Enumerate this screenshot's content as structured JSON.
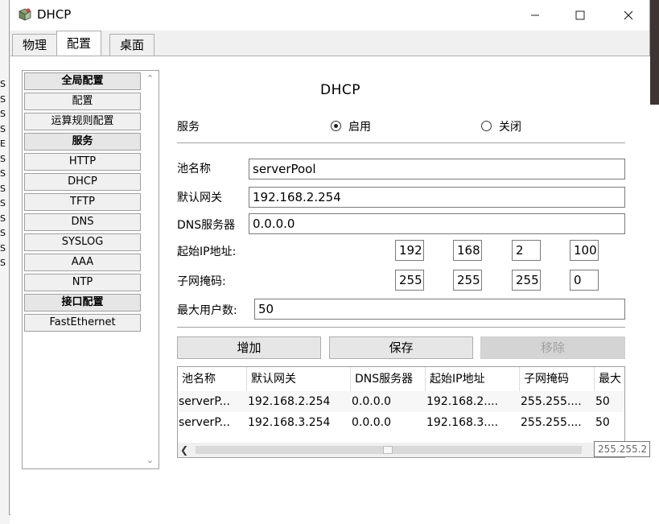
{
  "window": {
    "title": "DHCP",
    "tabs": [
      {
        "label": "物理"
      },
      {
        "label": "配置"
      },
      {
        "label": "桌面"
      }
    ]
  },
  "sidebar": {
    "items": [
      {
        "label": "全局配置",
        "header": true
      },
      {
        "label": "配置",
        "header": false
      },
      {
        "label": "运算规则配置",
        "header": false
      },
      {
        "label": "服务",
        "header": true
      },
      {
        "label": "HTTP",
        "header": false
      },
      {
        "label": "DHCP",
        "header": false
      },
      {
        "label": "TFTP",
        "header": false
      },
      {
        "label": "DNS",
        "header": false
      },
      {
        "label": "SYSLOG",
        "header": false
      },
      {
        "label": "AAA",
        "header": false
      },
      {
        "label": "NTP",
        "header": false
      },
      {
        "label": "接口配置",
        "header": true
      },
      {
        "label": "FastEthernet",
        "header": false
      }
    ]
  },
  "form": {
    "title": "DHCP",
    "service_label": "服务",
    "service_on": "启用",
    "service_off": "关闭",
    "pool_name_label": "池名称",
    "pool_name_value": "serverPool",
    "gateway_label": "默认网关",
    "gateway_value": "192.168.2.254",
    "dns_label": "DNS服务器",
    "dns_value": "0.0.0.0",
    "start_ip_label": "起始IP地址:",
    "start_ip": [
      "192",
      "168",
      "2",
      "100"
    ],
    "mask_label": "子网掩码:",
    "mask": [
      "255",
      "255",
      "255",
      "0"
    ],
    "max_users_label": "最大用户数:",
    "max_users_value": "50"
  },
  "buttons": {
    "add": "增加",
    "save": "保存",
    "remove": "移除"
  },
  "table": {
    "columns": [
      "池名称",
      "默认网关",
      "DNS服务器",
      "起始IP地址",
      "子网掩码",
      "最大"
    ],
    "rows": [
      [
        "serverP...",
        "192.168.2.254",
        "0.0.0.0",
        "192.168.2....",
        "255.255....",
        "50"
      ],
      [
        "serverP...",
        "192.168.3.254",
        "0.0.0.0",
        "192.168.3....",
        "255.255....",
        "50"
      ]
    ],
    "tooltip": "255.255.2"
  },
  "background": {
    "left_letters": [
      "S",
      "S",
      "S",
      "S",
      "E",
      "S",
      "S",
      "S",
      "S",
      "S",
      "S",
      "S",
      "S",
      "",
      "",
      " %",
      " %",
      "",
      "",
      "S",
      "S",
      "S",
      "S",
      "S"
    ]
  }
}
